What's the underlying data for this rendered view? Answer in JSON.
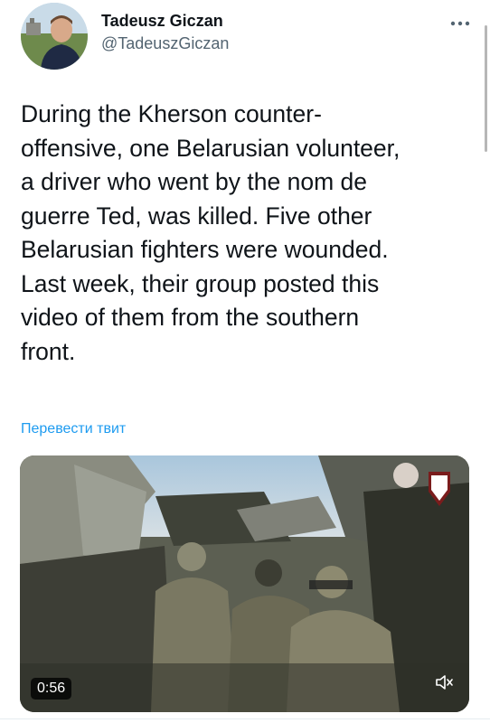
{
  "author": {
    "display_name": "Tadeusz Giczan",
    "handle": "@TadeuszGiczan"
  },
  "tweet": {
    "text": "During the Kherson counter-\noffensive, one Belarusian volunteer,\na driver who went by the nom de\nguerre Ted, was killed. Five other\nBelarusian fighters were wounded.\nLast week, their group posted this\nvideo of them from the southern\nfront.",
    "translate_label": "Перевести твит"
  },
  "media": {
    "duration": "0:56"
  },
  "icons": {
    "more": "more-options-icon",
    "mute": "speaker-muted-icon"
  },
  "colors": {
    "accent": "#1d9bf0",
    "text": "#0f1419",
    "secondary": "#536471"
  }
}
